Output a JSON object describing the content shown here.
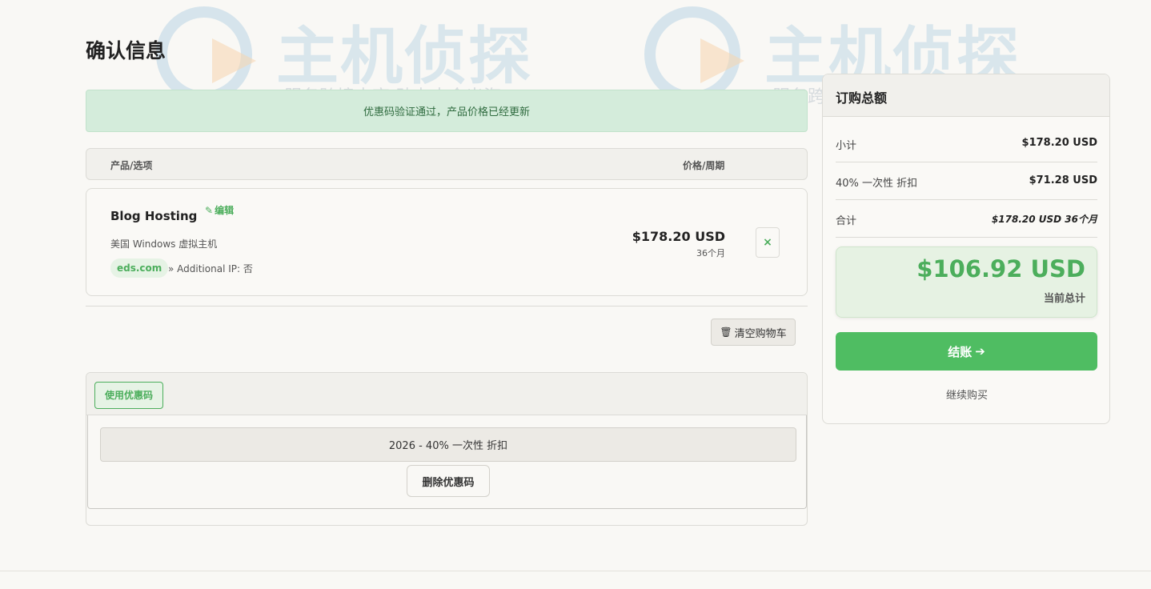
{
  "page": {
    "title": "确认信息"
  },
  "alert": {
    "message": "优惠码验证通过，产品价格已经更新"
  },
  "cart": {
    "headers": {
      "product": "产品/选项",
      "price": "价格/周期"
    },
    "item": {
      "name": "Blog Hosting",
      "edit_label": "编辑",
      "group": "美国 Windows 虚拟主机",
      "domain": "eds.com",
      "option": "» Additional IP: 否",
      "price": "$178.20 USD",
      "cycle": "36个月",
      "remove_symbol": "×"
    },
    "empty_cart_label": "清空购物车"
  },
  "promo": {
    "tab_label": "使用优惠码",
    "applied_code": "2026 - 40% 一次性 折扣",
    "remove_label": "删除优惠码"
  },
  "summary": {
    "title": "订购总额",
    "rows": [
      {
        "label": "小计",
        "value": "$178.20 USD"
      },
      {
        "label": "40% 一次性 折扣",
        "value": "$71.28 USD"
      },
      {
        "label": "合计",
        "value": "$178.20 USD 36个月"
      }
    ],
    "total_amount": "$106.92 USD",
    "total_label": "当前总计",
    "checkout_label": "结账",
    "continue_label": "继续购买"
  },
  "watermark": {
    "title": "主机侦探",
    "subtitle": "服务跨境电商 助力中企出海"
  },
  "colors": {
    "accent": "#4fbd62",
    "success_bg": "#d4ecdb",
    "page_bg": "#f9f8f5"
  }
}
